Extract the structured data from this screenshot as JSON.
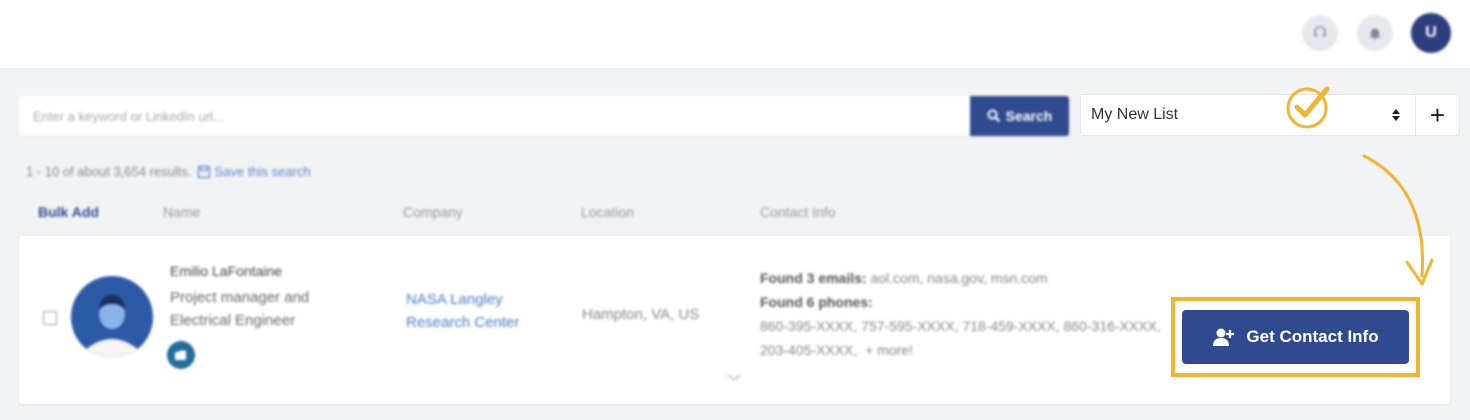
{
  "topbar": {
    "icons": [
      "headset-icon",
      "bell-icon"
    ],
    "user_initial": "U"
  },
  "search": {
    "placeholder": "Enter a keyword or LinkedIn url...",
    "button_label": "Search"
  },
  "list": {
    "selected": "My New List",
    "add_label": "+"
  },
  "results": {
    "summary": "1 - 10 of about 3,654 results.",
    "save_label": "Save this search"
  },
  "columns": {
    "bulk_add": "Bulk Add",
    "name": "Name",
    "company": "Company",
    "location": "Location",
    "contact": "Contact Info"
  },
  "contact_row": {
    "name": "Emilio LaFontaine",
    "title": "Project manager and Electrical Engineer",
    "company": "NASA Langley Research Center",
    "location": "Hampton, VA, US",
    "emails_label": "Found 3 emails:",
    "emails_value": "aol.com, nasa.gov, msn.com",
    "phones_label": "Found 6 phones:",
    "phones_value": "860-395-XXXX, 757-595-XXXX, 718-459-XXXX, 860-316-XXXX, 203-405-XXXX,",
    "more_label": "+ more!",
    "get_contact_label": "Get Contact Info"
  },
  "colors": {
    "primary": "#2f4a8f",
    "highlight": "#f2b531",
    "link": "#4a7cc4"
  }
}
